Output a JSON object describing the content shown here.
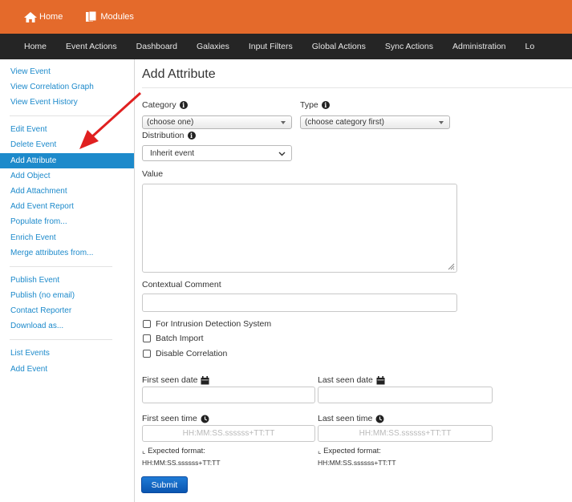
{
  "topbar": {
    "home_label": "Home",
    "modules_label": "Modules",
    "color": "#e46a2b"
  },
  "navbar": {
    "items": [
      "Home",
      "Event Actions",
      "Dashboard",
      "Galaxies",
      "Input Filters",
      "Global Actions",
      "Sync Actions",
      "Administration",
      "Lo"
    ]
  },
  "sidebar": {
    "items": [
      "View Event",
      "View Correlation Graph",
      "View Event History",
      "Edit Event",
      "Delete Event",
      "Add Attribute",
      "Add Object",
      "Add Attachment",
      "Add Event Report",
      "Populate from...",
      "Enrich Event",
      "Merge attributes from...",
      "Publish Event",
      "Publish (no email)",
      "Contact Reporter",
      "Download as...",
      "List Events",
      "Add Event"
    ],
    "active": "Add Attribute",
    "accent": "#1d8acb"
  },
  "form": {
    "title": "Add Attribute",
    "category_label": "Category",
    "category_value": "(choose one)",
    "type_label": "Type",
    "type_value": "(choose category first)",
    "distribution_label": "Distribution",
    "distribution_value": "Inherit event",
    "value_label": "Value",
    "comment_label": "Contextual Comment",
    "ids_label": "For Intrusion Detection System",
    "batch_label": "Batch Import",
    "disable_corr_label": "Disable Correlation",
    "first_seen_date_label": "First seen date",
    "last_seen_date_label": "Last seen date",
    "first_seen_time_label": "First seen time",
    "last_seen_time_label": "Last seen time",
    "time_placeholder": "HH:MM:SS.ssssss+TT:TT",
    "expected_label": "Expected format:",
    "expected_format": "HH:MM:SS.ssssss+TT:TT",
    "submit_label": "Submit"
  },
  "annotation": {
    "arrow_color": "#e02020"
  }
}
